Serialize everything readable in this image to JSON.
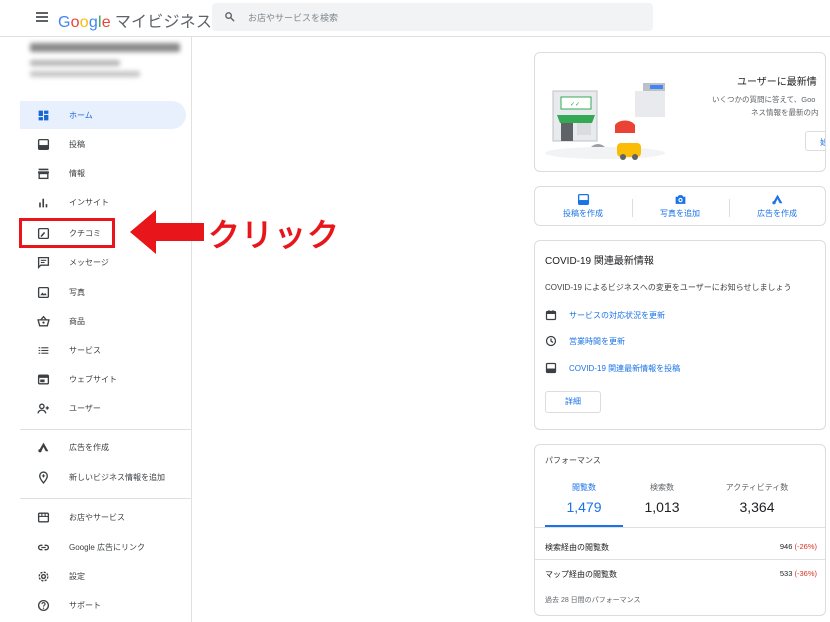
{
  "header": {
    "logo_google": "Google",
    "logo_product": "マイビジネス",
    "search_placeholder": "お店やサービスを検索"
  },
  "sidebar": {
    "items": [
      {
        "label": "ホーム",
        "icon": "dashboard-icon"
      },
      {
        "label": "投稿",
        "icon": "posts-icon"
      },
      {
        "label": "情報",
        "icon": "store-icon"
      },
      {
        "label": "インサイト",
        "icon": "insights-icon"
      },
      {
        "label": "クチコミ",
        "icon": "reviews-icon"
      },
      {
        "label": "メッセージ",
        "icon": "message-icon"
      },
      {
        "label": "写真",
        "icon": "photo-icon"
      },
      {
        "label": "商品",
        "icon": "basket-icon"
      },
      {
        "label": "サービス",
        "icon": "list-icon"
      },
      {
        "label": "ウェブサイト",
        "icon": "web-icon"
      },
      {
        "label": "ユーザー",
        "icon": "add-person-icon"
      },
      {
        "label": "広告を作成",
        "icon": "ads-icon"
      },
      {
        "label": "新しいビジネス情報を追加",
        "icon": "add-location-icon"
      },
      {
        "label": "お店やサービス",
        "icon": "storefront-icon"
      },
      {
        "label": "Google 広告にリンク",
        "icon": "link-icon"
      },
      {
        "label": "設定",
        "icon": "settings-icon"
      },
      {
        "label": "サポート",
        "icon": "help-icon"
      }
    ]
  },
  "annotation": {
    "label": "クリック",
    "color": "#e8161b"
  },
  "welcome_card": {
    "title": "ユーザーに最新情",
    "desc_line1": "いくつかの質問に答えて、Goo",
    "desc_line2": "ネス情報を最新の内",
    "start_label": "始"
  },
  "actions": [
    {
      "label": "投稿を作成",
      "icon": "post-icon"
    },
    {
      "label": "写真を追加",
      "icon": "camera-icon"
    },
    {
      "label": "広告を作成",
      "icon": "ads-icon"
    }
  ],
  "covid_card": {
    "title": "COVID-19 関連最新情報",
    "subtitle": "COVID-19 によるビジネスへの変更をユーザーにお知らせしましょう",
    "rows": [
      {
        "label": "サービスの対応状況を更新",
        "icon": "calendar-icon"
      },
      {
        "label": "営業時間を更新",
        "icon": "clock-icon"
      },
      {
        "label": "COVID-19 関連最新情報を投稿",
        "icon": "post-icon"
      }
    ],
    "detail_label": "詳細"
  },
  "performance": {
    "title": "パフォーマンス",
    "metrics": [
      {
        "label": "閲覧数",
        "value": "1,479",
        "selected": true
      },
      {
        "label": "検索数",
        "value": "1,013",
        "selected": false
      },
      {
        "label": "アクティビティ数",
        "value": "3,364",
        "selected": false
      }
    ],
    "rows": [
      {
        "label": "検索経由の閲覧数",
        "value": "946",
        "change": "(-26%)"
      },
      {
        "label": "マップ経由の閲覧数",
        "value": "533",
        "change": "(-36%)"
      }
    ],
    "footer": "過去 28 日間のパフォーマンス"
  },
  "colors": {
    "accent": "#1a73e8",
    "active_bg": "#e8f0fe",
    "negative": "#d93025"
  }
}
